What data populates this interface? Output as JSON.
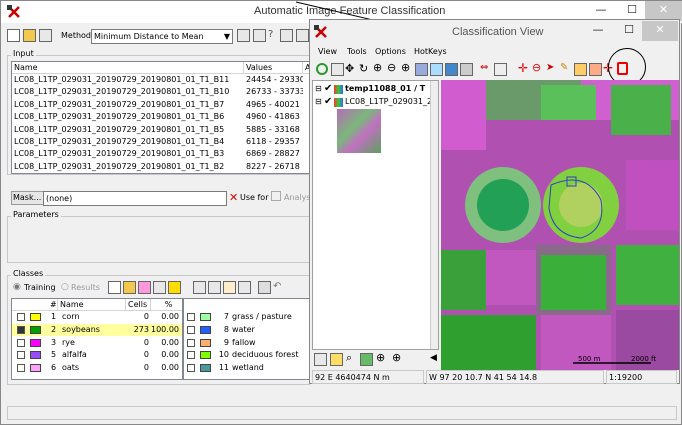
{
  "main_window": {
    "title": "Automatic Image Feature Classification",
    "minimize": "—",
    "maximize": "☐",
    "close": "✕",
    "method_label": "Method",
    "method_value": "Minimum Distance to Mean",
    "input_label": "Input",
    "columns": {
      "name": "Name",
      "values": "Values",
      "extra": "A"
    },
    "inputs": [
      {
        "name": "LC08_L1TP_029031_20190729_20190801_01_T1_B11",
        "values": "24454 - 29330"
      },
      {
        "name": "LC08_L1TP_029031_20190729_20190801_01_T1_B10",
        "values": "26733 - 33733"
      },
      {
        "name": "LC08_L1TP_029031_20190729_20190801_01_T1_B7",
        "values": "4965 - 40021"
      },
      {
        "name": "LC08_L1TP_029031_20190729_20190801_01_T1_B6",
        "values": "4960 - 41863"
      },
      {
        "name": "LC08_L1TP_029031_20190729_20190801_01_T1_B5",
        "values": "5885 - 33168"
      },
      {
        "name": "LC08_L1TP_029031_20190729_20190801_01_T1_B4",
        "values": "6118 - 29357"
      },
      {
        "name": "LC08_L1TP_029031_20190729_20190801_01_T1_B3",
        "values": "6869 - 28827"
      },
      {
        "name": "LC08_L1TP_029031_20190729_20190801_01_T1_B2",
        "values": "8227 - 26718"
      }
    ],
    "mask_button": "Mask...",
    "mask_value": "(none)",
    "use_for_label": "Use for",
    "analysis_label": "Analysi",
    "parameters_label": "Parameters",
    "classes_label": "Classes",
    "training_label": "Training",
    "results_label": "Results",
    "classes_columns": {
      "num": "#",
      "name": "Name",
      "cells": "Cells",
      "pct": "%"
    },
    "classes_left": [
      {
        "num": "1",
        "name": "corn",
        "cells": "0",
        "pct": "0.00",
        "color": "#ffff00",
        "checked": false
      },
      {
        "num": "2",
        "name": "soybeans",
        "cells": "273",
        "pct": "100.00",
        "color": "#00a000",
        "checked": true
      },
      {
        "num": "3",
        "name": "rye",
        "cells": "0",
        "pct": "0.00",
        "color": "#ff00ff",
        "checked": false
      },
      {
        "num": "5",
        "name": "alfalfa",
        "cells": "0",
        "pct": "0.00",
        "color": "#9a4dff",
        "checked": false
      },
      {
        "num": "6",
        "name": "oats",
        "cells": "0",
        "pct": "0.00",
        "color": "#ffa0ff",
        "checked": false
      }
    ],
    "classes_right": [
      {
        "num": "7",
        "name": "grass / pasture",
        "color": "#a0ffa0"
      },
      {
        "num": "8",
        "name": "water",
        "color": "#2060ff"
      },
      {
        "num": "9",
        "name": "fallow",
        "color": "#ffb070"
      },
      {
        "num": "10",
        "name": "deciduous forest",
        "color": "#80ff00"
      },
      {
        "num": "11",
        "name": "wetland",
        "color": "#4a9a9a"
      }
    ]
  },
  "classification_view": {
    "title": "Classification View",
    "menu": [
      "View",
      "Tools",
      "Options",
      "HotKeys"
    ],
    "layers": [
      {
        "name": "temp11088_01 / T"
      },
      {
        "name": "LC08_L1TP_029031_2"
      }
    ],
    "scale_left": "500 m",
    "scale_right": "2000 ft",
    "status_coord": "92 E  4640474 N m",
    "status_latlon": "W 97 20 10.7  N 41 54 14.8",
    "status_scale": "1:19200"
  },
  "colors": {
    "highlight_row": "#ffffa0",
    "map_magenta": "#c040c0",
    "map_green": "#30b040",
    "annotation_red": "#e00000"
  }
}
